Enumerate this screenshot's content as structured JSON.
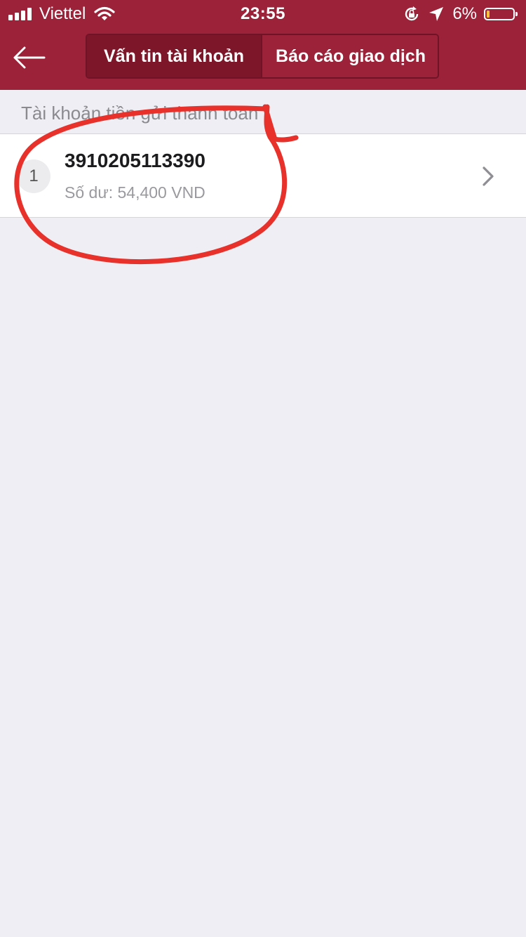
{
  "status_bar": {
    "carrier": "Viettel",
    "time": "23:55",
    "battery_percent": "6%",
    "battery_level": 0.06,
    "icons": [
      "signal-icon",
      "wifi-icon",
      "rotation-lock-icon",
      "location-arrow-icon",
      "battery-icon"
    ]
  },
  "nav": {
    "back_icon": "arrow-left-icon",
    "tabs": [
      {
        "label": "Vấn tin tài khoản",
        "active": true
      },
      {
        "label": "Báo cáo giao dịch",
        "active": false
      }
    ]
  },
  "section": {
    "title": "Tài khoản tiền gửi thanh toán"
  },
  "accounts": [
    {
      "index": "1",
      "number": "3910205113390",
      "balance": "Số dư: 54,400 VND"
    }
  ],
  "colors": {
    "header": "#9b2238",
    "active_tab": "#7c1628",
    "annotation": "#e8312a",
    "background": "#efeef4"
  }
}
